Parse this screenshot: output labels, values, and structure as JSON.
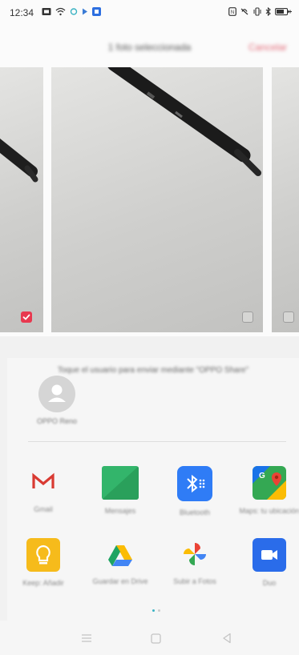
{
  "status_bar": {
    "time": "12:34",
    "left_icons": [
      "gallery-icon",
      "wifi-icon",
      "sync-icon",
      "play-icon",
      "app-notification-icon"
    ],
    "right_icons": [
      "nfc-icon",
      "vibrate-off-icon",
      "vibrate-icon",
      "bluetooth-icon",
      "battery-icon"
    ]
  },
  "header": {
    "title": "1 foto seleccionada",
    "cancel_label": "Cancelar"
  },
  "photos": [
    {
      "selected": true
    },
    {
      "selected": false
    },
    {
      "selected": false
    }
  ],
  "share": {
    "hint": "Toque el usuario para enviar mediante \"OPPO Share\"",
    "contact_name": "OPPO Reno",
    "apps": [
      {
        "label": "Gmail",
        "icon": "gmail-icon"
      },
      {
        "label": "Mensajes",
        "icon": "messages-icon"
      },
      {
        "label": "Bluetooth",
        "icon": "bluetooth-icon"
      },
      {
        "label": "Maps: tu ubicación",
        "icon": "maps-icon"
      },
      {
        "label": "Keep: Añadir",
        "icon": "keep-icon"
      },
      {
        "label": "Guardar en Drive",
        "icon": "drive-icon"
      },
      {
        "label": "Subir a Fotos",
        "icon": "photos-icon"
      },
      {
        "label": "Duo",
        "icon": "duo-icon"
      }
    ],
    "page_count": 2,
    "current_page": 1
  },
  "nav": {
    "icons": [
      "menu-icon",
      "home-icon",
      "back-icon"
    ]
  },
  "colors": {
    "accent": "#e8384f",
    "page_indicator": "#3bb3c3",
    "bluetooth_blue": "#2f7cf6",
    "duo_blue": "#2a6cea",
    "keep_yellow": "#f6bb1b"
  }
}
